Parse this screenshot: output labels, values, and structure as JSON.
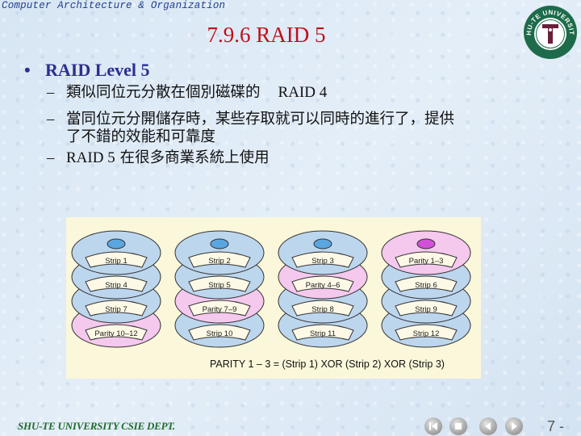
{
  "header": {
    "course": "Computer Architecture & Organization",
    "title": "7.9.6 RAID 5",
    "logo_text": "SHU-TE UNIVERSITY",
    "logo_letter": "T"
  },
  "content": {
    "bullet": "RAID Level 5",
    "bullet_symbol": "•",
    "dash": "–",
    "items": [
      {
        "text_cjk": "類似同位元分散在個別磁碟的",
        "text_latin": "RAID 4"
      },
      {
        "line1": "當同位元分開儲存時，某些存取就可以同時的進行了，提供",
        "line2": "了不錯的效能和可靠度"
      },
      {
        "text_latin": "RAID 5",
        "text_cjk": "在很多商業系統上使用"
      }
    ]
  },
  "figure": {
    "colors": {
      "disk": "#bcd6ee",
      "parity": "#f5c8ee",
      "hub": "#5aa6e0",
      "hub_parity": "#d050d8",
      "label_bg": "#fdf9e6",
      "background": "#fbf7da"
    },
    "disks": [
      {
        "platters": [
          {
            "label": "Strip 1",
            "type": "data"
          },
          {
            "label": "Strip 4",
            "type": "data"
          },
          {
            "label": "Strip 7",
            "type": "data"
          },
          {
            "label": "Parity 10–12",
            "type": "parity"
          }
        ]
      },
      {
        "platters": [
          {
            "label": "Strip 2",
            "type": "data"
          },
          {
            "label": "Strip 5",
            "type": "data"
          },
          {
            "label": "Parity 7–9",
            "type": "parity"
          },
          {
            "label": "Strip 10",
            "type": "data"
          }
        ]
      },
      {
        "platters": [
          {
            "label": "Strip 3",
            "type": "data"
          },
          {
            "label": "Parity 4–6",
            "type": "parity"
          },
          {
            "label": "Strip 8",
            "type": "data"
          },
          {
            "label": "Strip 11",
            "type": "data"
          }
        ]
      },
      {
        "platters": [
          {
            "label": "Parity 1–3",
            "type": "parity"
          },
          {
            "label": "Strip 6",
            "type": "data"
          },
          {
            "label": "Strip 9",
            "type": "data"
          },
          {
            "label": "Strip 12",
            "type": "data"
          }
        ]
      }
    ],
    "caption": "PARITY 1 – 3 = (Strip 1) XOR (Strip 2) XOR (Strip 3)"
  },
  "footer": {
    "dept": "SHU-TE UNIVERSITY  CSIE DEPT.",
    "page": "7 -",
    "nav": [
      "first-slide",
      "end-show",
      "previous-slide",
      "next-slide"
    ]
  }
}
